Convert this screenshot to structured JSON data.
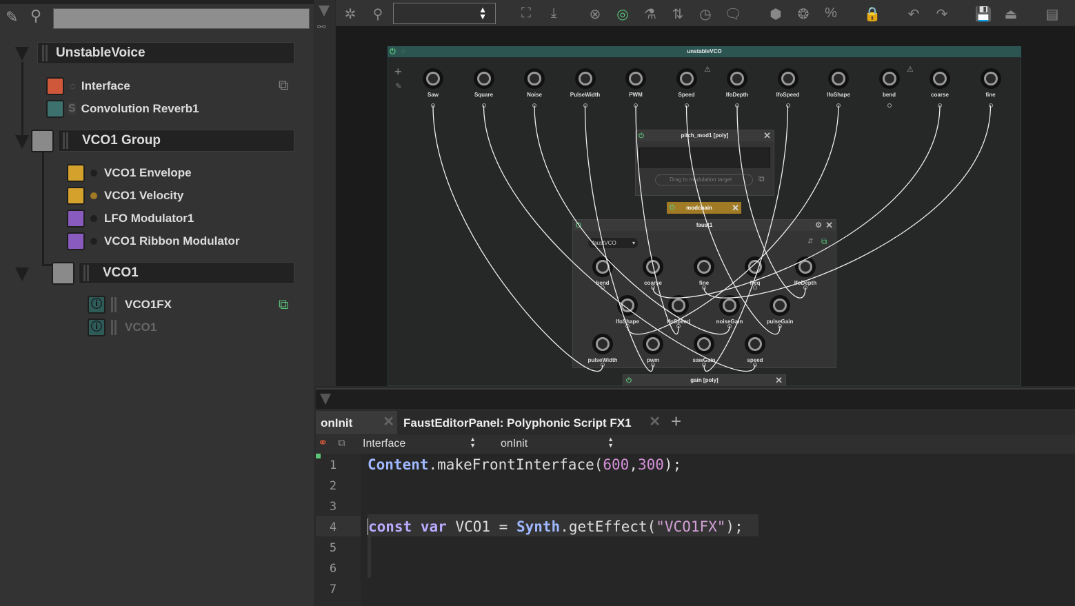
{
  "sidebar": {
    "search_value": "",
    "tree": {
      "root": {
        "label": "UnstableVoice"
      },
      "root_children": [
        {
          "label": "Interface",
          "color": "#d0583a",
          "icon": "midi-icon",
          "has_popout": true
        },
        {
          "label": "Convolution Reverb1",
          "color": "#3d716e",
          "icon": "s-icon"
        }
      ],
      "group": {
        "label": "VCO1 Group",
        "color": "#8a8a8a"
      },
      "group_children": [
        {
          "label": "VCO1 Envelope",
          "color": "#d4a12c",
          "dot": "#1f1f1f"
        },
        {
          "label": "VCO1 Velocity",
          "color": "#d4a12c",
          "dot": "#a07a25"
        },
        {
          "label": "LFO Modulator1",
          "color": "#8a5bbf",
          "dot": "#1f1f1f"
        },
        {
          "label": "VCO1 Ribbon Modulator",
          "color": "#8a5bbf",
          "dot": "#1f1f1f"
        }
      ],
      "vco": {
        "label": "VCO1",
        "color": "#8a8a8a"
      },
      "vco_children": [
        {
          "label": "VCO1FX",
          "enabled": true,
          "has_popout": true
        },
        {
          "label": "VCO1",
          "enabled": false
        }
      ]
    }
  },
  "toolbar": {
    "combo_value": "",
    "icons": [
      "snowflake-icon",
      "zoom-icon",
      "fit-icon",
      "import-icon",
      "cancel-icon",
      "active-icon",
      "flask-icon",
      "tuning-icon",
      "clock-icon",
      "comment-icon",
      "cube-icon",
      "network-icon",
      "percent-icon",
      "lock-icon",
      "undo-icon",
      "redo-icon",
      "save-icon",
      "eject-icon",
      "layout-icon"
    ]
  },
  "graph": {
    "module_title": "unstableVCO",
    "knobs": [
      "Saw",
      "Square",
      "Noise",
      "PulseWidth",
      "PWM",
      "Speed",
      "lfoDepth",
      "lfoSpeed",
      "lfoShape",
      "bend",
      "coarse",
      "fine"
    ],
    "pitch_mod": {
      "title": "pitch_mod1 [poly]",
      "drag_label": "Drag to modulation target"
    },
    "modchain": {
      "title": "modchain",
      "color": "#a07a25"
    },
    "faust": {
      "title": "faust1",
      "selector": "faustVCO",
      "knobs": [
        "bend",
        "coarse",
        "fine",
        "freq",
        "lfoDepth",
        "lfoShape",
        "lfoSpeed",
        "noiseGain",
        "pulseGain",
        "pulseWidth",
        "pwm",
        "sawGain",
        "speed"
      ]
    },
    "gain": {
      "title": "gain [poly]"
    }
  },
  "editor": {
    "tabs": [
      {
        "label": "onInit"
      },
      {
        "label": "FaustEditorPanel: Polyphonic Script FX1"
      }
    ],
    "processor_select": "Interface",
    "callback_select": "onInit",
    "line_numbers": [
      "1",
      "2",
      "3",
      "4",
      "5",
      "6",
      "7"
    ],
    "code": {
      "l1": {
        "obj": "Content",
        "rest": ".makeFrontInterface(",
        "n1": "600",
        "comma": ",",
        "n2": "300",
        "end": ");"
      },
      "l4": {
        "kw1": "const",
        "kw2": "var",
        "name": " VCO1 = ",
        "obj": "Synth",
        "rest": ".getEffect(",
        "str": "\"VCO1FX\"",
        "end": ");"
      }
    }
  }
}
